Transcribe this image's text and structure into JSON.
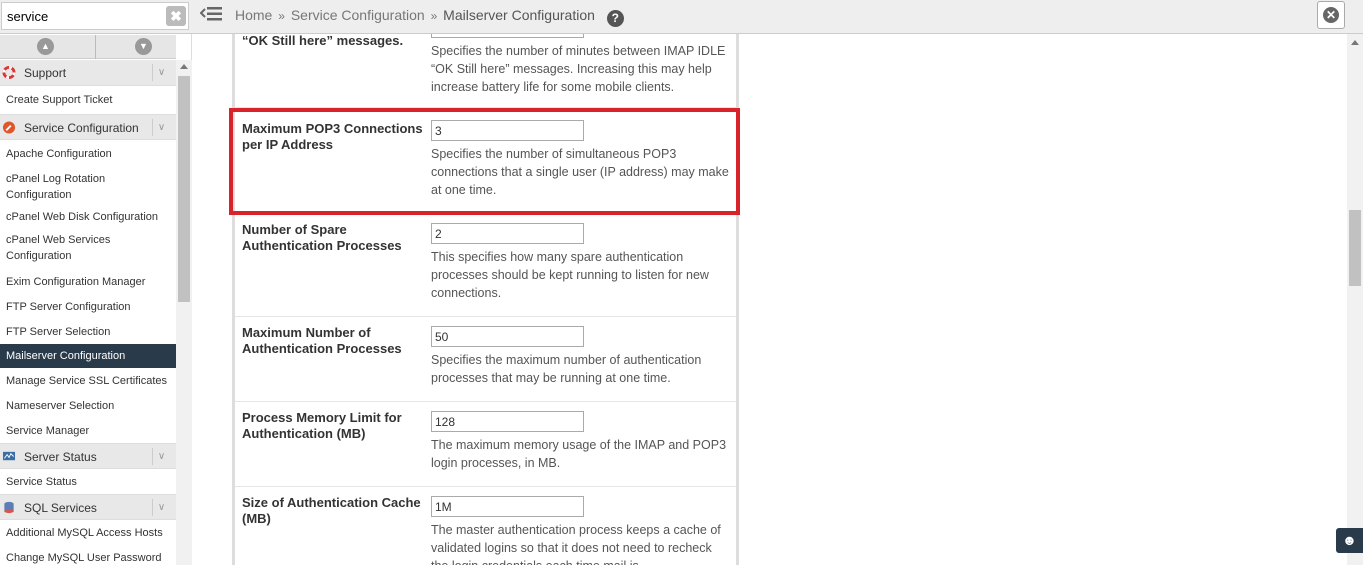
{
  "search": {
    "value": "service",
    "clear_glyph": "✖"
  },
  "collapse": {
    "up_glyph": "▲",
    "down_glyph": "▼"
  },
  "sidebar": {
    "categories": {
      "support": {
        "label": "Support",
        "icon": "lifebuoy-icon"
      },
      "service_configuration": {
        "label": "Service Configuration",
        "icon": "wrench-icon"
      },
      "server_status": {
        "label": "Server Status",
        "icon": "monitor-icon"
      },
      "sql_services": {
        "label": "SQL Services",
        "icon": "database-icon"
      }
    },
    "items": [
      "Create Support Ticket",
      "Apache Configuration",
      "cPanel Log Rotation Configuration",
      "cPanel Web Disk Configuration",
      "cPanel Web Services Configuration",
      "Exim Configuration Manager",
      "FTP Server Configuration",
      "FTP Server Selection",
      "Mailserver Configuration",
      "Manage Service SSL Certificates",
      "Nameserver Selection",
      "Service Manager",
      "Service Status",
      "Additional MySQL Access Hosts",
      "Change MySQL User Password"
    ],
    "chevron_glyph": "∨"
  },
  "breadcrumb": {
    "home": "Home",
    "sep": "»",
    "section": "Service Configuration",
    "current": "Mailserver Configuration",
    "help_glyph": "?"
  },
  "close_glyph": "✕",
  "settings": [
    {
      "label": "“OK Still here” messages.",
      "value": "",
      "description": "Specifies the number of minutes between IMAP IDLE “OK Still here” messages. Increasing this may help increase battery life for some mobile clients."
    },
    {
      "label": "Maximum POP3 Connections per IP Address",
      "value": "3",
      "description": "Specifies the number of simultaneous POP3 connections that a single user (IP address) may make at one time."
    },
    {
      "label": "Number of Spare Authentication Processes",
      "value": "2",
      "description": "This specifies how many spare authentication processes should be kept running to listen for new connections."
    },
    {
      "label": "Maximum Number of Authentication Processes",
      "value": "50",
      "description": "Specifies the maximum number of authentication processes that may be running at one time."
    },
    {
      "label": "Process Memory Limit for Authentication (MB)",
      "value": "128",
      "description": "The maximum memory usage of the IMAP and POP3 login processes, in MB."
    },
    {
      "label": "Size of Authentication Cache (MB)",
      "value": "1M",
      "description": "The master authentication process keeps a cache of validated logins so that it does not need to recheck the login credentials each time mail is"
    }
  ],
  "chat_glyph": "☻",
  "colors": {
    "highlight": "#d8232a",
    "active_nav": "#293a4a"
  }
}
